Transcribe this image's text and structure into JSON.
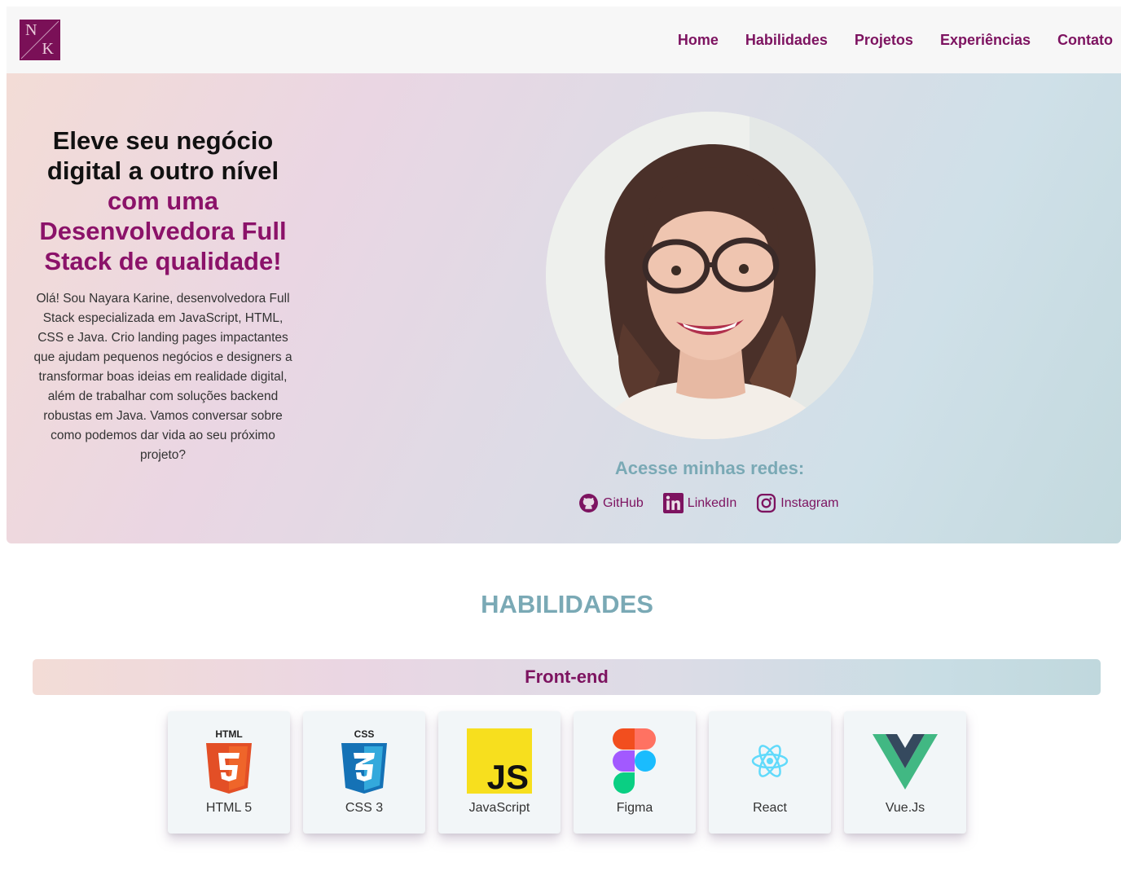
{
  "header": {
    "logo": {
      "letter1": "N",
      "letter2": "K"
    },
    "nav": [
      "Home",
      "Habilidades",
      "Projetos",
      "Experiências",
      "Contato"
    ]
  },
  "hero": {
    "title_line1": "Eleve seu negócio",
    "title_line2": "digital a outro nível",
    "title_accent": "com uma Desenvolvedora Full Stack de qualidade!",
    "description": "Olá! Sou Nayara Karine, desenvolvedora Full Stack especializada em JavaScript, HTML, CSS e Java. Crio landing pages impactantes que ajudam pequenos negócios e designers a transformar boas ideias em realidade digital, além de trabalhar com soluções backend robustas em Java. Vamos conversar sobre como podemos dar vida ao seu próximo projeto?",
    "social_title": "Acesse minhas redes:",
    "socials": [
      {
        "label": "GitHub",
        "icon": "github-icon"
      },
      {
        "label": "LinkedIn",
        "icon": "linkedin-icon"
      },
      {
        "label": "Instagram",
        "icon": "instagram-icon"
      }
    ]
  },
  "skills": {
    "title": "HABILIDADES",
    "frontend_label": "Front-end",
    "items": [
      {
        "label": "HTML 5",
        "icon": "html5-icon"
      },
      {
        "label": "CSS 3",
        "icon": "css3-icon"
      },
      {
        "label": "JavaScript",
        "icon": "javascript-icon"
      },
      {
        "label": "Figma",
        "icon": "figma-icon"
      },
      {
        "label": "React",
        "icon": "react-icon"
      },
      {
        "label": "Vue.Js",
        "icon": "vue-icon"
      }
    ]
  },
  "colors": {
    "accent": "#7d1360",
    "teal": "#7aa9b5",
    "header_bg": "#f7f7f7"
  }
}
